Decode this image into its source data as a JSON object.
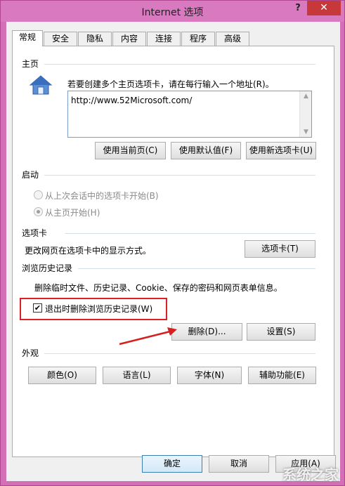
{
  "window": {
    "title": "Internet 选项",
    "help_label": "?",
    "close_label": "✕"
  },
  "tabs": [
    "常规",
    "安全",
    "隐私",
    "内容",
    "连接",
    "程序",
    "高级"
  ],
  "homepage": {
    "title": "主页",
    "description": "若要创建多个主页选项卡，请在每行输入一个地址(R)。",
    "url": "http://www.52Microsoft.com/",
    "buttons": [
      "使用当前页(C)",
      "使用默认值(F)",
      "使用新选项卡(U)"
    ]
  },
  "startup": {
    "title": "启动",
    "options": [
      "从上次会话中的选项卡开始(B)",
      "从主页开始(H)"
    ],
    "selected_index": 1
  },
  "tabs_group": {
    "title": "选项卡",
    "description": "更改网页在选项卡中的显示方式。",
    "button": "选项卡(T)"
  },
  "history": {
    "title": "浏览历史记录",
    "description": "删除临时文件、历史记录、Cookie、保存的密码和网页表单信息。",
    "checkbox_label": "退出时删除浏览历史记录(W)",
    "checkbox_checked": true,
    "checkbox_mark": "✔",
    "delete_button": "删除(D)...",
    "settings_button": "设置(S)"
  },
  "appearance": {
    "title": "外观",
    "buttons": [
      "颜色(O)",
      "语言(L)",
      "字体(N)",
      "辅助功能(E)"
    ]
  },
  "footer": {
    "ok": "确定",
    "cancel": "取消",
    "apply": "应用(A)"
  },
  "watermark": "系统之家",
  "colors": {
    "window_frame": "#d36fb6",
    "close_button": "#c7383a",
    "annotation_red": "#e02020"
  }
}
